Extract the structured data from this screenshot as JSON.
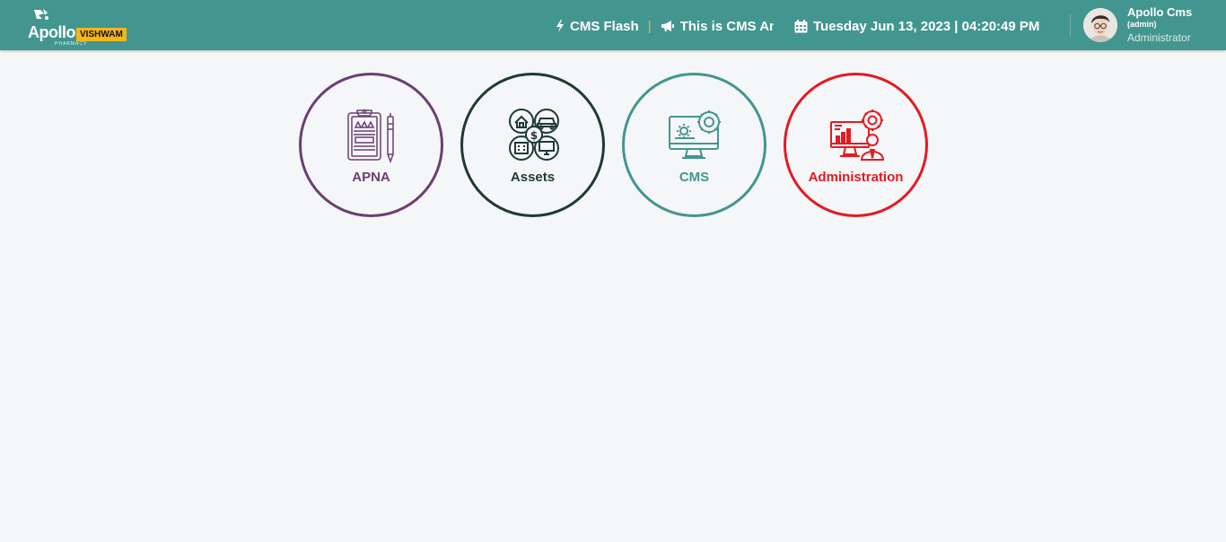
{
  "brand": {
    "logo_word": "Apollo",
    "logo_sub": "PHARMACY",
    "badge": "VISHWAM"
  },
  "flash": {
    "title": "CMS Flash",
    "separator": "|",
    "message": "This is CMS Announcement"
  },
  "datetime": {
    "text": "Tuesday Jun 13, 2023 | 04:20:49 PM"
  },
  "user": {
    "name": "Apollo Cms",
    "id": "(admin)",
    "role": "Administrator"
  },
  "modules": [
    {
      "label": "APNA",
      "icon": "clipboard-checklist-icon",
      "color": "#6b3f73"
    },
    {
      "label": "Assets",
      "icon": "assets-icon",
      "color": "#1f3a33"
    },
    {
      "label": "CMS",
      "icon": "monitor-gears-icon",
      "color": "#43968f"
    },
    {
      "label": "Administration",
      "icon": "admin-dashboard-icon",
      "color": "#e21b23"
    }
  ],
  "colors": {
    "header": "#43968f",
    "badge": "#f3b719",
    "background": "#f5f6f8"
  }
}
